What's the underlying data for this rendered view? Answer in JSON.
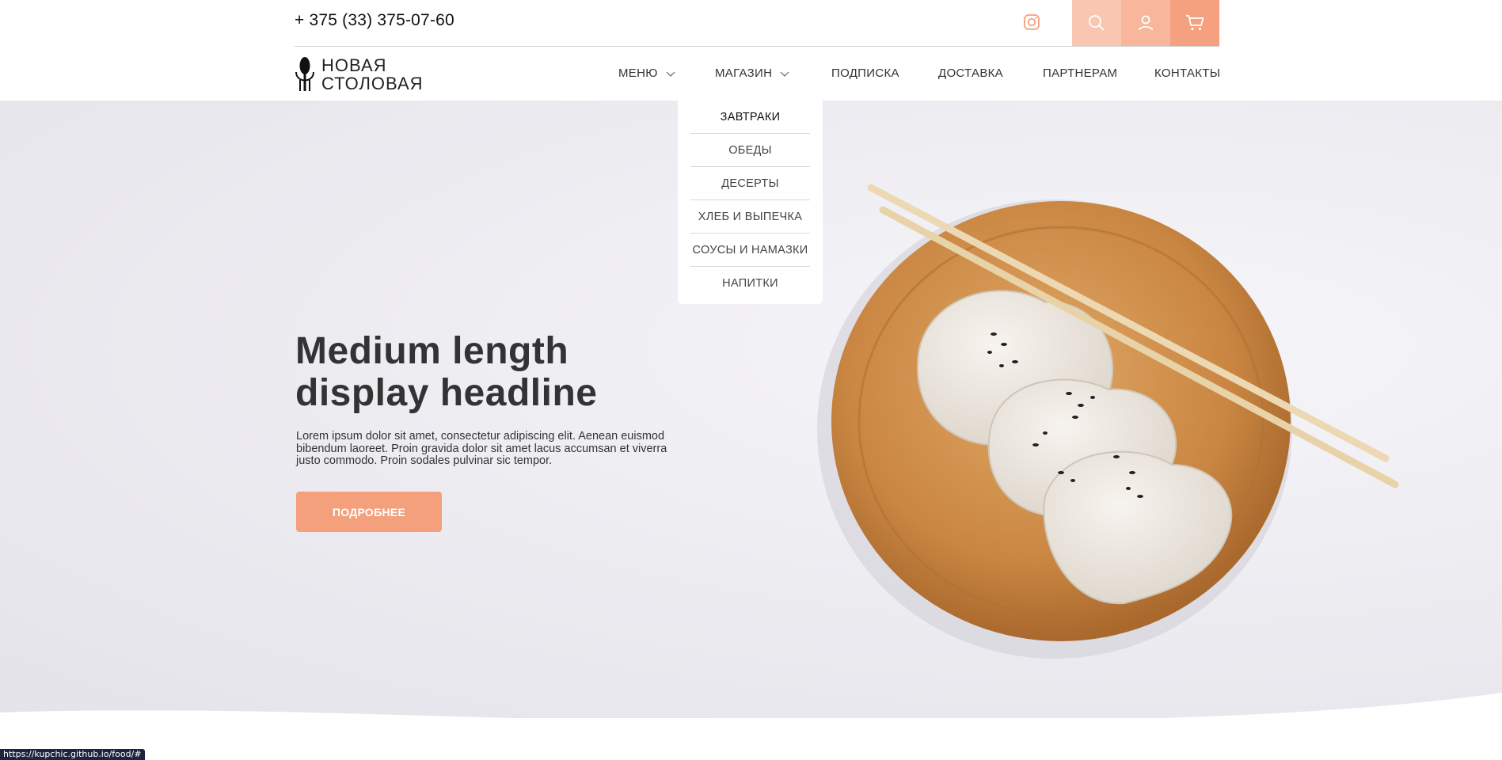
{
  "header": {
    "phone": "+ 375 (33) 375-07-60",
    "icons": {
      "instagram": "instagram-icon",
      "search": "search-icon",
      "user": "user-icon",
      "cart": "cart-icon"
    },
    "accent_colors": [
      "#f9c6b2",
      "#f8b69c",
      "#f5a07e"
    ]
  },
  "logo": {
    "line1": "НОВАЯ",
    "line2": "СТОЛОВАЯ"
  },
  "nav": {
    "items": [
      {
        "label": "МЕНЮ",
        "has_dropdown": true
      },
      {
        "label": "МАГАЗИН",
        "has_dropdown": true
      },
      {
        "label": "ПОДПИСКА"
      },
      {
        "label": "ДОСТАВКА"
      },
      {
        "label": "ПАРТНЕРАМ"
      },
      {
        "label": "КОНТАКТЫ"
      }
    ]
  },
  "dropdown": {
    "items": [
      "ЗАВТРАКИ",
      "ОБЕДЫ",
      "ДЕСЕРТЫ",
      "ХЛЕБ И ВЫПЕЧКА",
      "СОУСЫ И НАМАЗКИ",
      "НАПИТКИ"
    ]
  },
  "hero": {
    "headline_line1": "Medium length",
    "headline_line2": "display headline",
    "body": "Lorem ipsum dolor sit amet, consectetur adipiscing elit. Aenean euismod bibendum laoreet. Proin gravida dolor sit amet lacus accumsan et viverra justo commodo. Proin sodales pulvinar sic tempor.",
    "cta_label": "ПОДРОБНЕЕ",
    "cta_color": "#f4a07c"
  },
  "status_bar": {
    "url": "https://kupchic.github.io/food/#"
  }
}
